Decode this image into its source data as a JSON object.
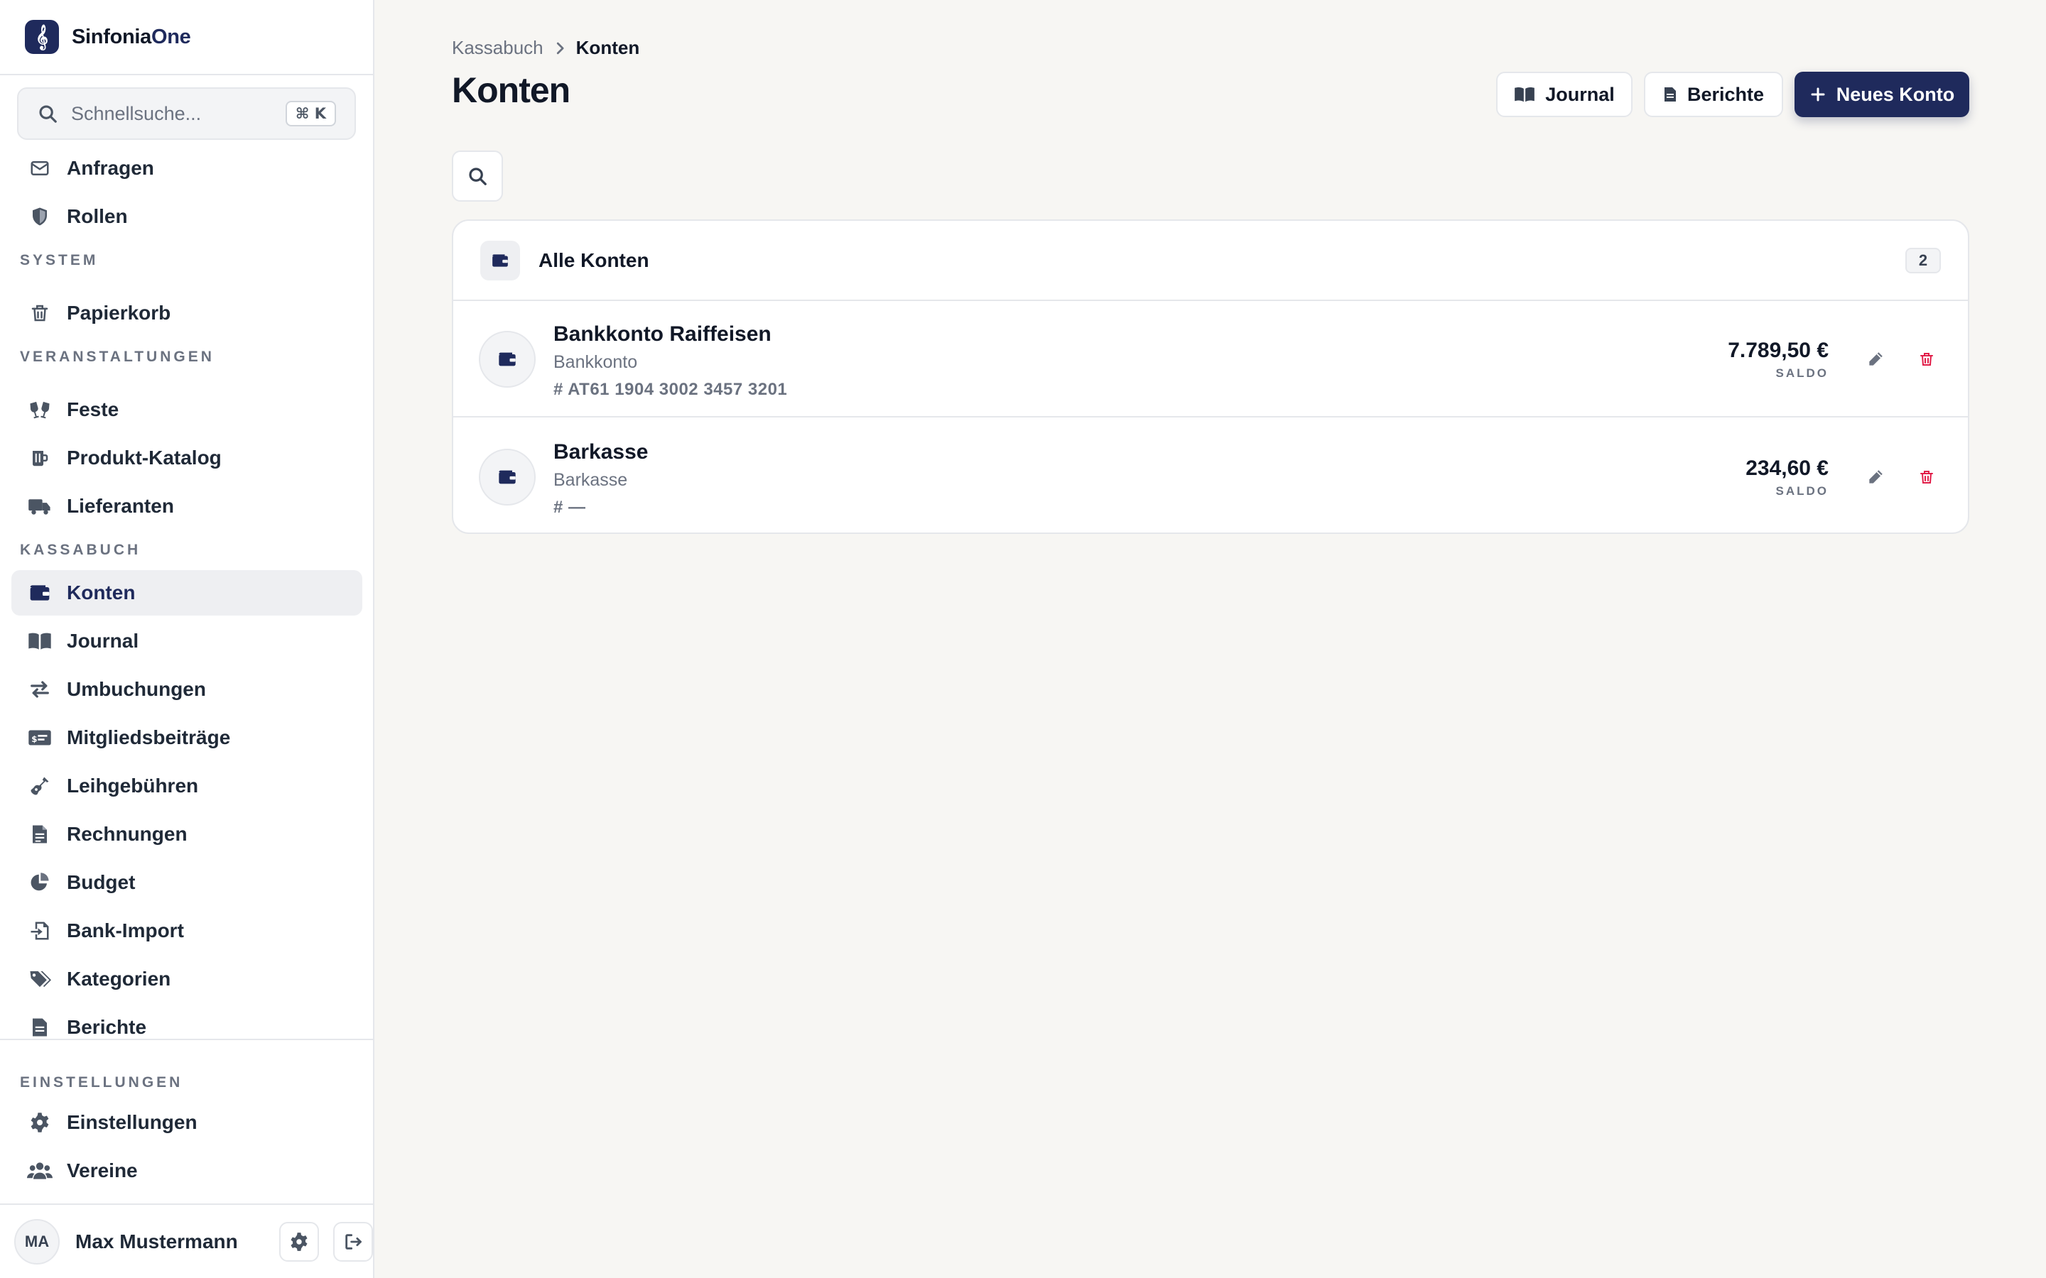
{
  "app": {
    "name_main": "Sinfonia",
    "name_accent": "One",
    "logo_icon": "treble-clef-icon"
  },
  "sidebar": {
    "search": {
      "placeholder": "Schnellsuche...",
      "shortcut": "⌘ K"
    },
    "items_top": [
      {
        "label": "Anfragen",
        "icon": "envelope-icon"
      },
      {
        "label": "Rollen",
        "icon": "shield-icon"
      }
    ],
    "sections": {
      "system": "SYSTEM",
      "veranstaltungen": "VERANSTALTUNGEN",
      "kassabuch": "KASSABUCH",
      "einstellungen": "EINSTELLUNGEN"
    },
    "system_items": [
      {
        "label": "Papierkorb",
        "icon": "trash-icon"
      }
    ],
    "veranstaltungen_items": [
      {
        "label": "Feste",
        "icon": "glasses-cheers-icon"
      },
      {
        "label": "Produkt-Katalog",
        "icon": "mug-icon"
      },
      {
        "label": "Lieferanten",
        "icon": "truck-icon"
      }
    ],
    "kassabuch_items": [
      {
        "label": "Konten",
        "icon": "wallet-icon",
        "active": true
      },
      {
        "label": "Journal",
        "icon": "book-open-icon"
      },
      {
        "label": "Umbuchungen",
        "icon": "arrows-exchange-icon"
      },
      {
        "label": "Mitgliedsbeiträge",
        "icon": "money-card-icon"
      },
      {
        "label": "Leihgebühren",
        "icon": "guitar-icon"
      },
      {
        "label": "Rechnungen",
        "icon": "invoice-icon"
      },
      {
        "label": "Budget",
        "icon": "pie-chart-icon"
      },
      {
        "label": "Bank-Import",
        "icon": "file-import-icon"
      },
      {
        "label": "Kategorien",
        "icon": "tags-icon"
      },
      {
        "label": "Berichte",
        "icon": "report-icon"
      }
    ],
    "einstellungen_items": [
      {
        "label": "Einstellungen",
        "icon": "gear-icon"
      },
      {
        "label": "Vereine",
        "icon": "users-icon"
      }
    ],
    "user": {
      "initials": "MA",
      "name": "Max Mustermann"
    }
  },
  "main": {
    "breadcrumb": {
      "parent": "Kassabuch",
      "current": "Konten"
    },
    "title": "Konten",
    "buttons": {
      "journal": "Journal",
      "berichte": "Berichte",
      "new_account": "Neues Konto"
    },
    "accounts_card": {
      "title": "Alle Konten",
      "count": "2",
      "rows": [
        {
          "name": "Bankkonto Raiffeisen",
          "type": "Bankkonto",
          "iban": "# AT61 1904 3002 3457 3201",
          "amount": "7.789,50 €",
          "amount_label": "SALDO"
        },
        {
          "name": "Barkasse",
          "type": "Barkasse",
          "iban": "# —",
          "amount": "234,60 €",
          "amount_label": "SALDO"
        }
      ]
    }
  },
  "colors": {
    "primary": "#1f2a5c",
    "danger": "#e11d48",
    "background": "#f7f6f3"
  }
}
